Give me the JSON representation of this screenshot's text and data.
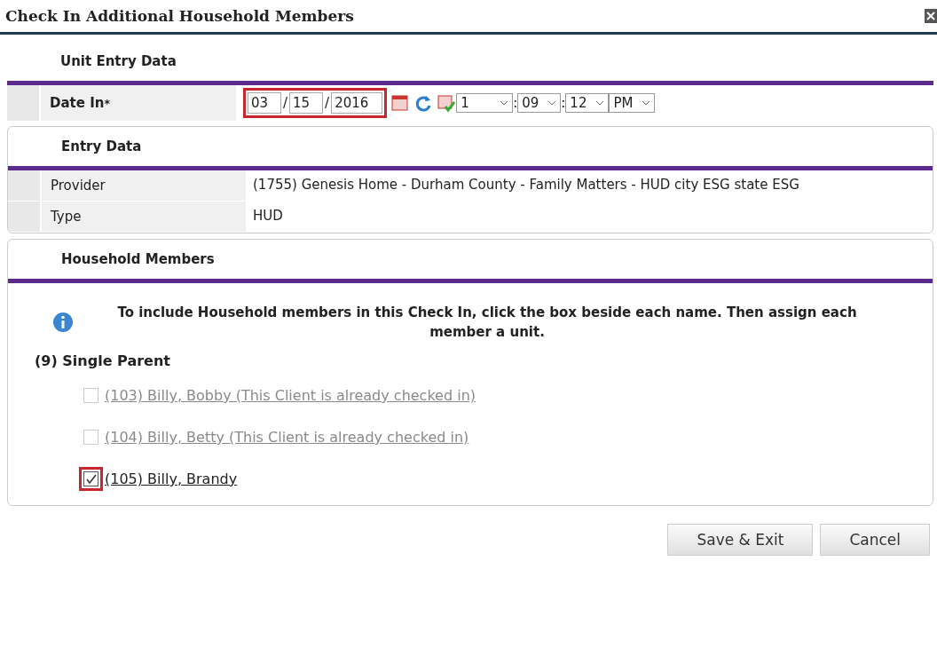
{
  "window": {
    "title": "Check In Additional Household Members"
  },
  "unit_entry": {
    "heading": "Unit Entry Data",
    "date_label": "Date In",
    "required_mark": "*",
    "month": "03",
    "day": "15",
    "year": "2016",
    "highlighted": true,
    "separators": [
      "/",
      "/"
    ],
    "hour": "1",
    "minute": "09",
    "second": "12",
    "ampm": "PM",
    "time_separators": [
      ":",
      ":"
    ]
  },
  "entry_data": {
    "heading": "Entry Data",
    "rows": [
      {
        "label": "Provider",
        "value": "(1755) Genesis Home - Durham County - Family Matters - HUD city ESG state ESG"
      },
      {
        "label": "Type",
        "value": "HUD"
      }
    ]
  },
  "household": {
    "heading": "Household Members",
    "info": "To include Household members in this Check In, click the box beside each name. Then assign each member a unit.",
    "group": "(9) Single Parent",
    "members": [
      {
        "label": "(103) Billy, Bobby (This Client is already checked in)",
        "checked": false,
        "disabled": true,
        "highlighted": false
      },
      {
        "label": "(104) Billy, Betty (This Client is already checked in)",
        "checked": false,
        "disabled": true,
        "highlighted": false
      },
      {
        "label": "(105) Billy, Brandy",
        "checked": true,
        "disabled": false,
        "highlighted": true
      }
    ]
  },
  "buttons": [
    "Save & Exit",
    "Cancel"
  ]
}
